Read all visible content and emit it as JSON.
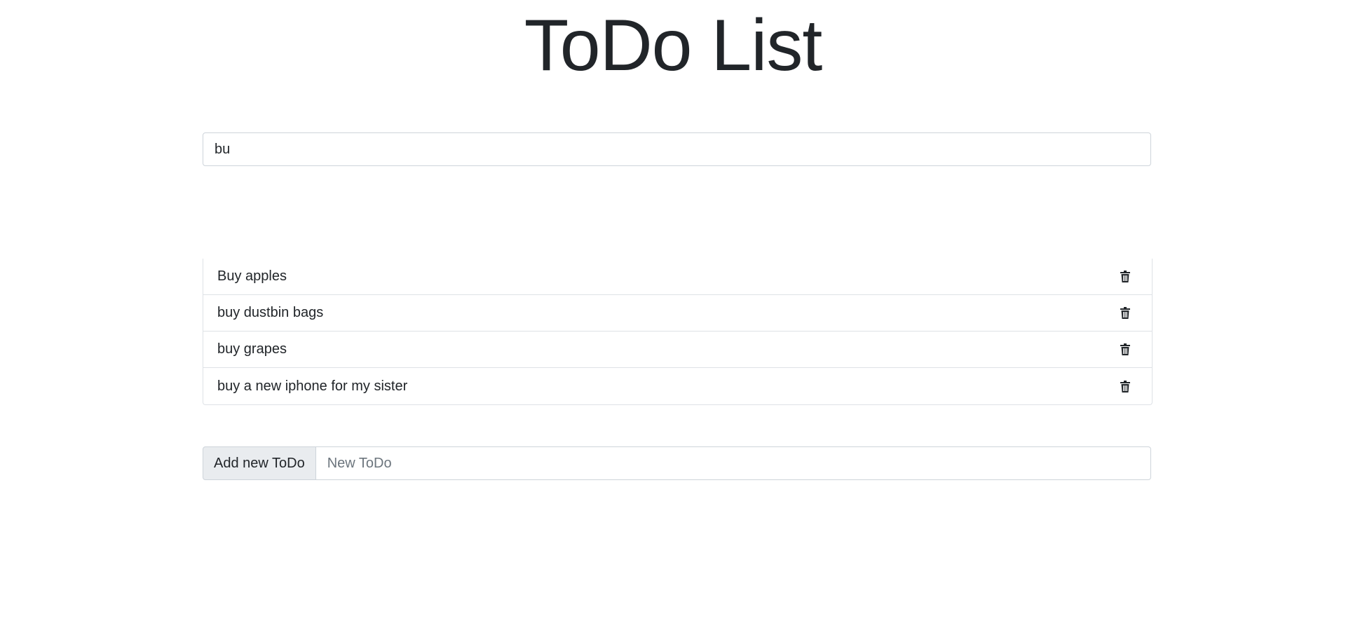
{
  "header": {
    "title": "ToDo List"
  },
  "search": {
    "value": "bu",
    "placeholder": ""
  },
  "todos": {
    "items": [
      {
        "label": "Buy apples",
        "icon": "trash-icon"
      },
      {
        "label": "buy dustbin bags",
        "icon": "trash-icon"
      },
      {
        "label": "buy grapes",
        "icon": "trash-icon"
      },
      {
        "label": "buy a new iphone for my sister",
        "icon": "trash-icon"
      }
    ]
  },
  "add": {
    "label": "Add new ToDo",
    "placeholder": "New ToDo",
    "value": ""
  },
  "colors": {
    "text": "#212529",
    "border": "#dee2e6",
    "label_bg": "#e9ecef"
  }
}
